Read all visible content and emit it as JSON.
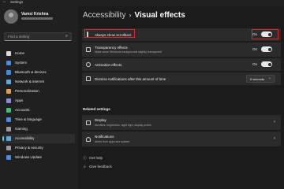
{
  "window": {
    "app_title": "Settings"
  },
  "user": {
    "name": "Vamsi Krishna"
  },
  "search": {
    "placeholder": "Find a setting"
  },
  "sidebar": {
    "items": [
      {
        "label": "Home",
        "color": "#d9d9d9"
      },
      {
        "label": "System",
        "color": "#3a8ee6"
      },
      {
        "label": "Bluetooth & devices",
        "color": "#3a8ee6"
      },
      {
        "label": "Network & internet",
        "color": "#5aa8e6"
      },
      {
        "label": "Personalization",
        "color": "#e6a23a"
      },
      {
        "label": "Apps",
        "color": "#8a8ae6"
      },
      {
        "label": "Accounts",
        "color": "#3ac27a"
      },
      {
        "label": "Time & language",
        "color": "#3a8ee6"
      },
      {
        "label": "Gaming",
        "color": "#9a9a9a"
      },
      {
        "label": "Accessibility",
        "color": "#5aa8e6"
      },
      {
        "label": "Privacy & security",
        "color": "#9a9a9a"
      },
      {
        "label": "Windows Update",
        "color": "#3a8ee6"
      }
    ]
  },
  "breadcrumb": {
    "parent": "Accessibility",
    "separator": "›",
    "current": "Visual effects"
  },
  "settings": {
    "scrollbars": {
      "title": "Always show scrollbars",
      "state": "On"
    },
    "transparency": {
      "title": "Transparency effects",
      "desc": "Make some Windows backgrounds slightly transparent",
      "state": "On"
    },
    "animation": {
      "title": "Animation effects",
      "state": "On"
    },
    "dismiss": {
      "title": "Dismiss notifications after this amount of time",
      "value": "5 seconds"
    }
  },
  "related": {
    "heading": "Related settings",
    "display": {
      "title": "Display",
      "desc": "Monitors, brightness, night light, display profile"
    },
    "notifications": {
      "title": "Notifications",
      "desc": "Alerts from apps and system"
    }
  },
  "help": {
    "get_help": "Get help",
    "feedback": "Give feedback"
  },
  "highlight_color": "#e02424"
}
